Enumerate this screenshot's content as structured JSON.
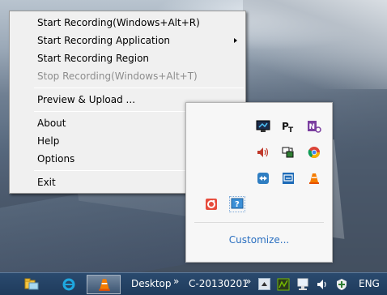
{
  "context_menu": {
    "items": [
      {
        "label": "Start Recording(Windows+Alt+R)",
        "enabled": true
      },
      {
        "label": "Start Recording Application",
        "enabled": true,
        "submenu": true
      },
      {
        "label": "Start Recording Region",
        "enabled": true
      },
      {
        "label": "Stop Recording(Windows+Alt+T)",
        "enabled": false
      },
      {
        "label": "Preview & Upload ...",
        "enabled": true
      },
      {
        "label": "About",
        "enabled": true
      },
      {
        "label": "Help",
        "enabled": true
      },
      {
        "label": "Options",
        "enabled": true
      },
      {
        "label": "Exit",
        "enabled": true
      }
    ]
  },
  "tray_flyout": {
    "icons": [
      "network-monitor-icon",
      "pt-icon",
      "onenote-icon",
      "speaker-icon",
      "sync-icon",
      "chrome-icon",
      "teamviewer-icon",
      "remote-desktop-icon",
      "vlc-icon",
      "recorder-icon",
      "help-icon"
    ],
    "customize_label": "Customize..."
  },
  "taskbar": {
    "pinned_icons": [
      "file-explorer-icon",
      "ie-icon",
      "vlc-icon"
    ],
    "toolbar_label": "Desktop",
    "toolbar_chevron": "»",
    "computer_label": "C-20130201",
    "computer_chevron": "»",
    "tray_icons": [
      "show-hidden-icons-icon",
      "gpu-icon",
      "network-icon",
      "volume-icon",
      "action-center-icon"
    ],
    "language": "ENG"
  }
}
